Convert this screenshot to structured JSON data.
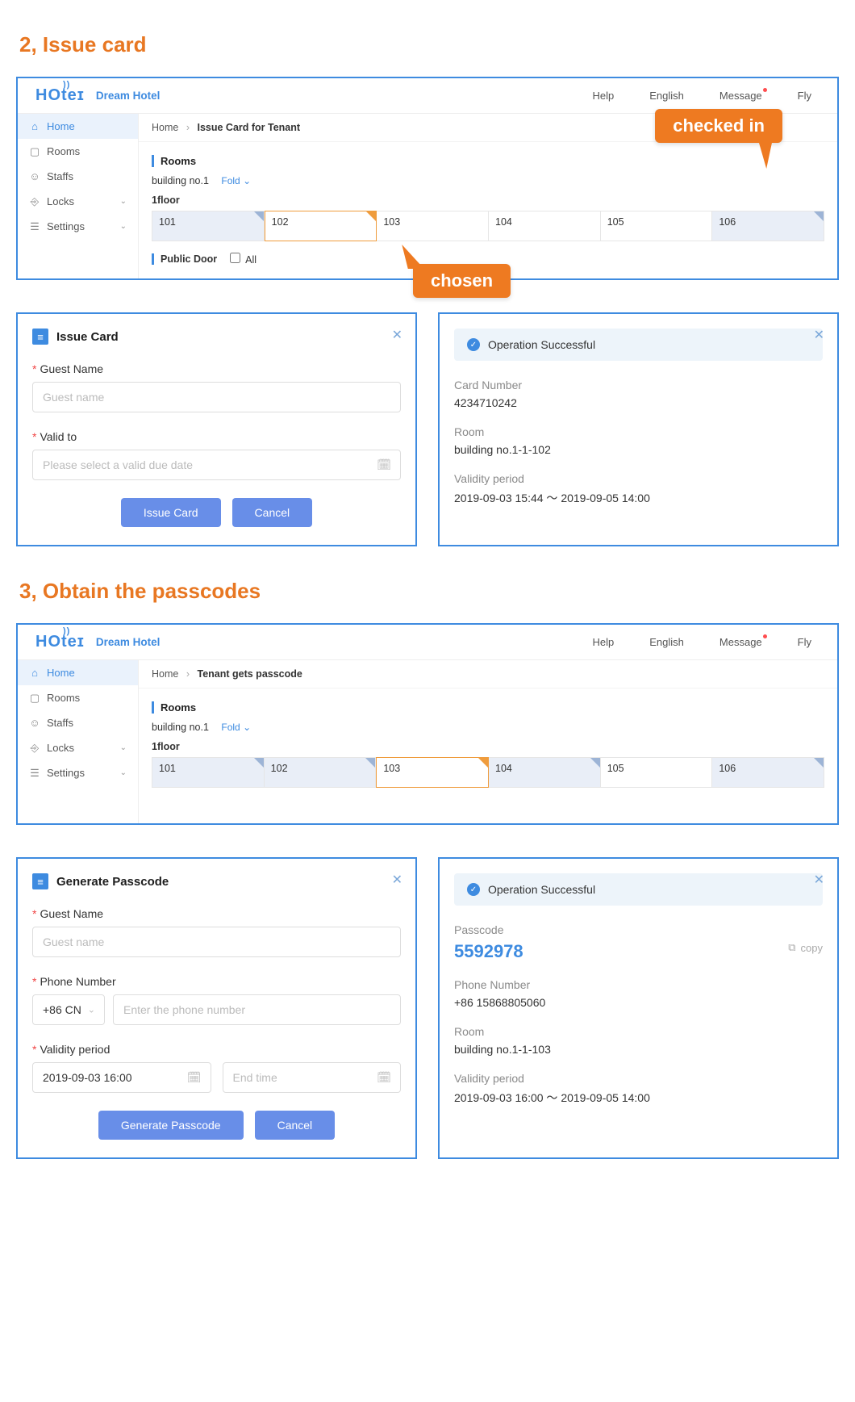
{
  "section2": {
    "title": "2, Issue card",
    "app": {
      "hotel_name": "Dream Hotel",
      "nav": {
        "help": "Help",
        "lang": "English",
        "message": "Message",
        "user": "Fly"
      },
      "sidebar": [
        {
          "label": "Home",
          "active": true,
          "chev": false
        },
        {
          "label": "Rooms",
          "active": false,
          "chev": false
        },
        {
          "label": "Staffs",
          "active": false,
          "chev": false
        },
        {
          "label": "Locks",
          "active": false,
          "chev": true
        },
        {
          "label": "Settings",
          "active": false,
          "chev": true
        }
      ],
      "breadcrumb": {
        "root": "Home",
        "current": "Issue Card for Tenant"
      },
      "rooms_label": "Rooms",
      "building": "building no.1",
      "fold": "Fold",
      "floor": "1floor",
      "rooms": [
        {
          "no": "101",
          "state": "checked"
        },
        {
          "no": "102",
          "state": "chosen"
        },
        {
          "no": "103",
          "state": "plain"
        },
        {
          "no": "104",
          "state": "plain"
        },
        {
          "no": "105",
          "state": "plain"
        },
        {
          "no": "106",
          "state": "checked"
        }
      ],
      "public_door": {
        "label": "Public Door",
        "all": "All"
      }
    },
    "callouts": {
      "checked_in": "checked in",
      "chosen": "chosen"
    },
    "issue_card": {
      "title": "Issue Card",
      "guest_label": "Guest Name",
      "guest_ph": "Guest name",
      "valid_label": "Valid to",
      "valid_ph": "Please select a valid due date",
      "btn_issue": "Issue Card",
      "btn_cancel": "Cancel"
    },
    "result": {
      "banner": "Operation Successful",
      "card_label": "Card Number",
      "card_val": "4234710242",
      "room_label": "Room",
      "room_val": "building no.1-1-102",
      "period_label": "Validity period",
      "period_val": "2019-09-03 15:44  ～  2019-09-05 14:00"
    }
  },
  "section3": {
    "title": "3, Obtain the passcodes",
    "app": {
      "hotel_name": "Dream Hotel",
      "nav": {
        "help": "Help",
        "lang": "English",
        "message": "Message",
        "user": "Fly"
      },
      "sidebar": [
        {
          "label": "Home",
          "active": true,
          "chev": false
        },
        {
          "label": "Rooms",
          "active": false,
          "chev": false
        },
        {
          "label": "Staffs",
          "active": false,
          "chev": false
        },
        {
          "label": "Locks",
          "active": false,
          "chev": true
        },
        {
          "label": "Settings",
          "active": false,
          "chev": true
        }
      ],
      "breadcrumb": {
        "root": "Home",
        "current": "Tenant gets passcode"
      },
      "rooms_label": "Rooms",
      "building": "building no.1",
      "fold": "Fold",
      "floor": "1floor",
      "rooms": [
        {
          "no": "101",
          "state": "checked"
        },
        {
          "no": "102",
          "state": "checked"
        },
        {
          "no": "103",
          "state": "chosen"
        },
        {
          "no": "104",
          "state": "checked"
        },
        {
          "no": "105",
          "state": "plain"
        },
        {
          "no": "106",
          "state": "checked"
        }
      ]
    },
    "gen": {
      "title": "Generate Passcode",
      "guest_label": "Guest Name",
      "guest_ph": "Guest name",
      "phone_label": "Phone Number",
      "cc_val": "+86 CN",
      "phone_ph": "Enter the phone number",
      "period_label": "Validity period",
      "start_val": "2019-09-03 16:00",
      "end_ph": "End time",
      "btn_gen": "Generate Passcode",
      "btn_cancel": "Cancel"
    },
    "result": {
      "banner": "Operation Successful",
      "passcode_label": "Passcode",
      "passcode_val": "5592978",
      "copy": "copy",
      "phone_label": "Phone Number",
      "phone_val": "+86 15868805060",
      "room_label": "Room",
      "room_val": "building no.1-1-103",
      "period_label": "Validity period",
      "period_val": "2019-09-03 16:00  ～  2019-09-05 14:00"
    }
  }
}
